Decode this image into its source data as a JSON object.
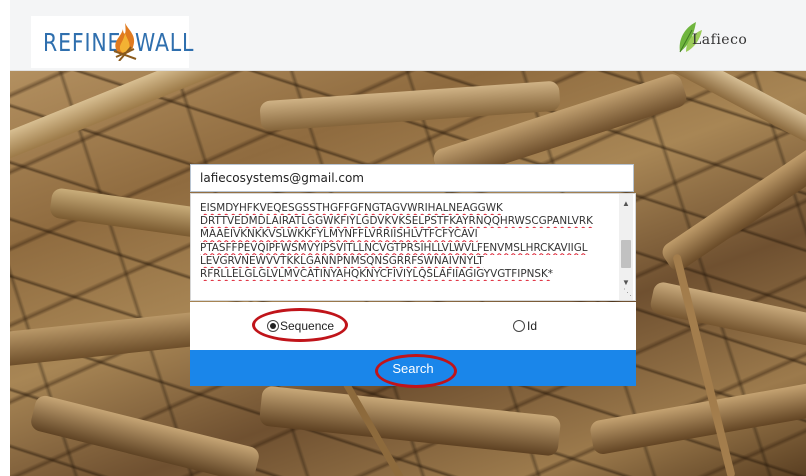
{
  "header": {
    "brand_left_part1": "REFINE",
    "brand_left_part2": "WALL",
    "brand_right": "Lafieco"
  },
  "form": {
    "email_value": "lafiecosystems@gmail.com",
    "sequence_lines": [
      "EISMDYHFKVEQESGSSTHGFFGFNGTAGVWRIHALNEAGGWK",
      "DRTTVEDMDLAIRATLGGWKFIYLGDVKVKSELPSTFKAYRNQQHRWSCGPANLVRK",
      "MAAEIVKNKKVSLWKKFYLMYNFFLVRRIISHLVTFCFYCAVI",
      "PTASFFPEVQIPFWSMVYIPSVITLLNCVGTPRSIHLLVLWVLFENVMSLHRCKAVIIGL",
      "LEVGRVNEWVVTKKLGANNPNMSQNSGRRFSWNAIVNYLT",
      "RFRLLELGLGLVLMVCATINYAHQKNYCFIVIYLQSLAFIIAGIGYVGTFIPNSK*"
    ],
    "radio_sequence_label": "Sequence",
    "radio_id_label": "Id",
    "selected_option": "Sequence",
    "search_label": "Search",
    "accent_color": "#1a86ea",
    "highlight_color": "#c0141a"
  }
}
